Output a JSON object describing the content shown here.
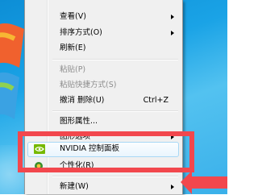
{
  "colors": {
    "desktop": "#1aa3e6",
    "menu_bg": "#f0f0f0",
    "disabled_text": "#8d8d8d",
    "highlight_border": "#f2474d",
    "nvidia_green": "#76b900"
  },
  "menu": {
    "items": [
      {
        "label": "查看(V)",
        "submenu": true
      },
      {
        "label": "排序方式(O)",
        "submenu": true
      },
      {
        "label": "刷新(E)"
      },
      {
        "label": "粘贴(P)",
        "disabled": true
      },
      {
        "label": "粘贴快捷方式(S)",
        "disabled": true
      },
      {
        "label": "撤消 删除(U)",
        "shortcut": "Ctrl+Z"
      },
      {
        "label": "图形属性..."
      },
      {
        "label": "图形选项",
        "submenu": true
      },
      {
        "label": "NVIDIA 控制面板",
        "icon": "nvidia-icon"
      },
      {
        "label": "个性化(R)",
        "icon": "personalize-icon"
      },
      {
        "label": "新建(W)",
        "submenu": true
      }
    ]
  }
}
